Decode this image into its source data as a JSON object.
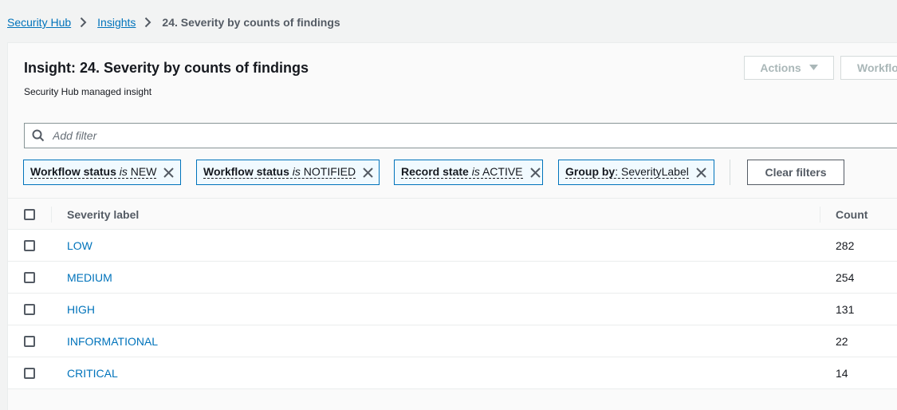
{
  "breadcrumb": {
    "items": [
      "Security Hub",
      "Insights"
    ],
    "current": "24. Severity by counts of findings"
  },
  "header": {
    "title": "Insight: 24. Severity by counts of findings",
    "subtitle": "Security Hub managed insight",
    "actions_label": "Actions",
    "workflow_label": "Workflo"
  },
  "filter": {
    "placeholder": "Add filter",
    "value": ""
  },
  "tokens": [
    {
      "key": "Workflow status",
      "op": "is",
      "value": "NEW"
    },
    {
      "key": "Workflow status",
      "op": "is",
      "value": "NOTIFIED"
    },
    {
      "key": "Record state",
      "op": "is",
      "value": "ACTIVE"
    },
    {
      "key": "Group by",
      "op": ":",
      "value": "SeverityLabel"
    }
  ],
  "clear_filters_label": "Clear filters",
  "table": {
    "columns": [
      "Severity label",
      "Count"
    ],
    "rows": [
      {
        "label": "LOW",
        "count": "282"
      },
      {
        "label": "MEDIUM",
        "count": "254"
      },
      {
        "label": "HIGH",
        "count": "131"
      },
      {
        "label": "INFORMATIONAL",
        "count": "22"
      },
      {
        "label": "CRITICAL",
        "count": "14"
      }
    ]
  },
  "colors": {
    "link": "#0073bb",
    "token_border": "#0073bb",
    "token_bg": "#f1faff",
    "disabled_text": "#aab7b8"
  },
  "icons": {
    "breadcrumb_separator": "chevron-right-icon",
    "search": "search-icon",
    "remove_token": "close-icon",
    "dropdown": "caret-down-icon"
  }
}
